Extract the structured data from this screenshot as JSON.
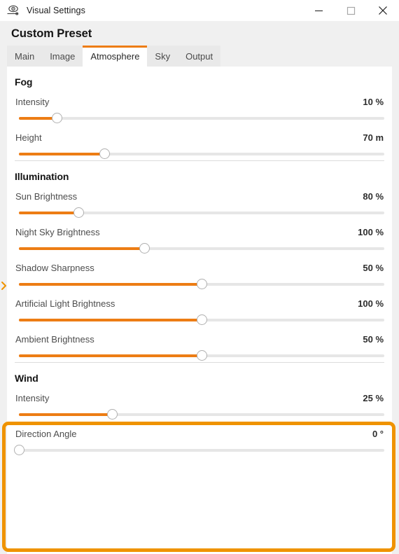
{
  "accent_color": "#ed7d14",
  "highlight_color": "#ef9300",
  "window": {
    "icon": "eye-visual-icon",
    "title": "Visual Settings",
    "controls": {
      "minimize": "minimize-icon",
      "maximize": "maximize-icon",
      "close": "close-icon"
    }
  },
  "header": {
    "preset_title": "Custom Preset"
  },
  "tabs": [
    {
      "label": "Main",
      "active": false
    },
    {
      "label": "Image",
      "active": false
    },
    {
      "label": "Atmosphere",
      "active": true
    },
    {
      "label": "Sky",
      "active": false
    },
    {
      "label": "Output",
      "active": false
    }
  ],
  "left_edge": {
    "expander_icon": "chevron-right-icon"
  },
  "sections": [
    {
      "title": "Fog",
      "highlighted": false,
      "rows": [
        {
          "label": "Intensity",
          "value": "10",
          "unit": "%",
          "fill_pct": 10.5
        },
        {
          "label": "Height",
          "value": "70",
          "unit": "m",
          "fill_pct": 23.5
        }
      ]
    },
    {
      "title": "Illumination",
      "highlighted": false,
      "rows": [
        {
          "label": "Sun Brightness",
          "value": "80",
          "unit": "%",
          "fill_pct": 16.3
        },
        {
          "label": "Night Sky Brightness",
          "value": "100",
          "unit": "%",
          "fill_pct": 34.3
        },
        {
          "label": "Shadow Sharpness",
          "value": "50",
          "unit": "%",
          "fill_pct": 50.0
        },
        {
          "label": "Artificial Light Brightness",
          "value": "100",
          "unit": "%",
          "fill_pct": 50.0
        },
        {
          "label": "Ambient Brightness",
          "value": "50",
          "unit": "%",
          "fill_pct": 50.0
        }
      ]
    },
    {
      "title": "Wind",
      "highlighted": true,
      "rows": [
        {
          "label": "Intensity",
          "value": "25",
          "unit": "%",
          "fill_pct": 25.5
        },
        {
          "label": "Direction Angle",
          "value": "0",
          "unit": "°",
          "fill_pct": 0.0
        }
      ]
    }
  ]
}
